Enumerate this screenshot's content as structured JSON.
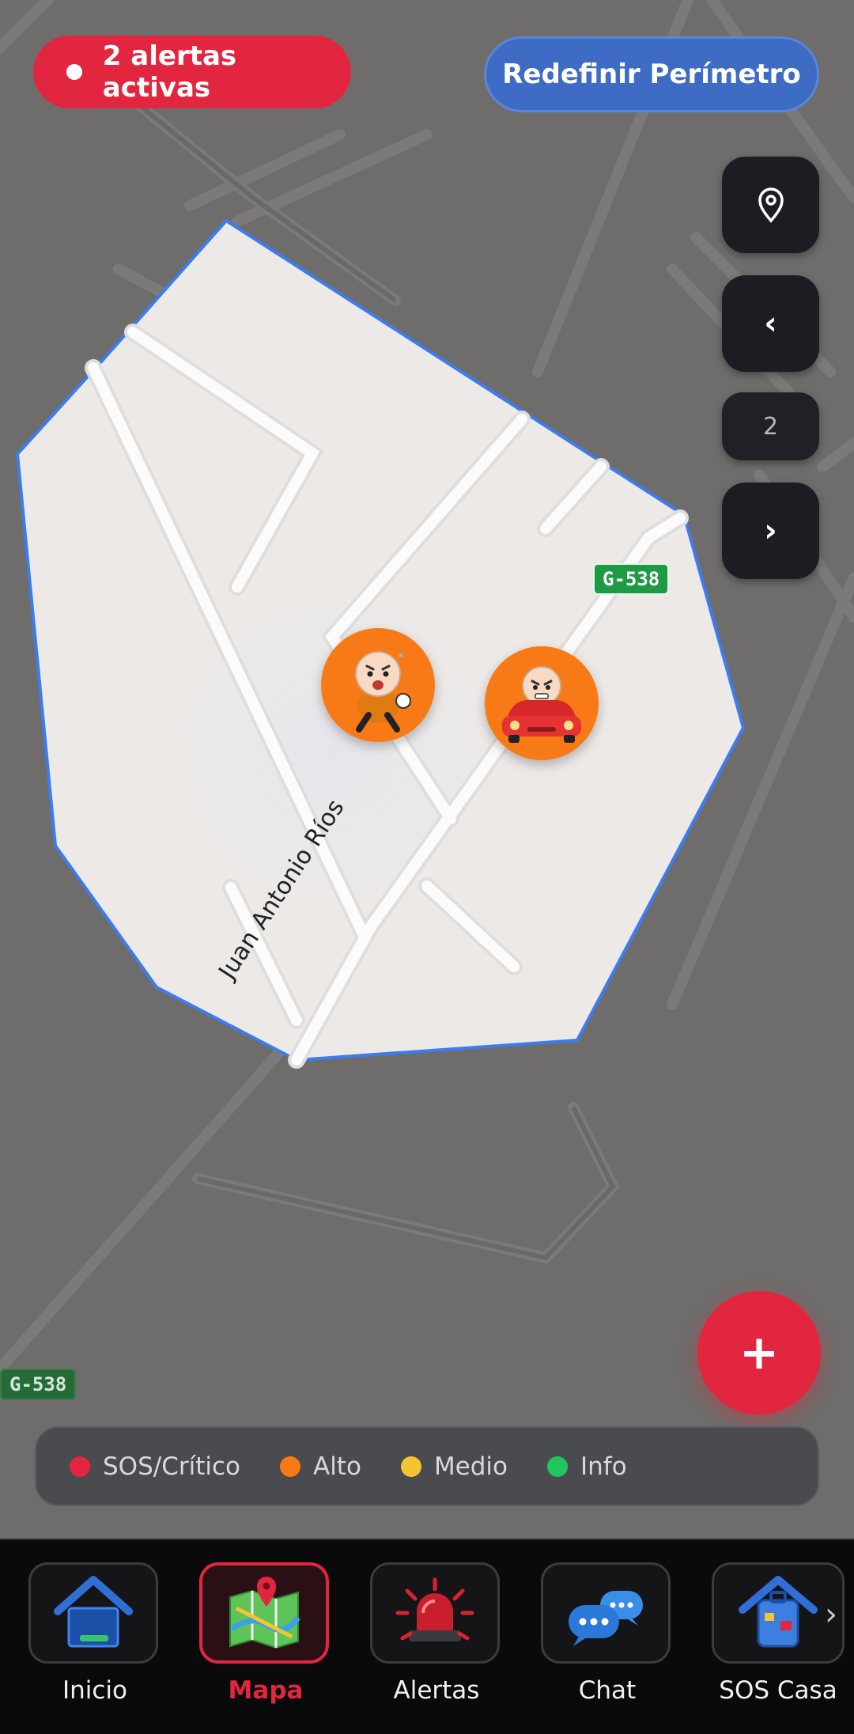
{
  "header": {
    "alerts_pill": "2 alertas activas",
    "perimeter_button": "Redefinir Perímetro"
  },
  "map_controls": {
    "page_number": "2",
    "prev_glyph": "‹",
    "next_glyph": "›"
  },
  "map": {
    "road_label_main": "G-538",
    "road_label_bottom": "G-538",
    "street_name": "Juan Antonio Ríos"
  },
  "fab": {
    "label": "+"
  },
  "legend": {
    "items": [
      {
        "label": "SOS/Crítico",
        "color": "#e3263f"
      },
      {
        "label": "Alto",
        "color": "#f77a16"
      },
      {
        "label": "Medio",
        "color": "#f5c531"
      },
      {
        "label": "Info",
        "color": "#22c55e"
      }
    ]
  },
  "nav": {
    "items": [
      {
        "label": "Inicio",
        "icon": "home-icon"
      },
      {
        "label": "Mapa",
        "icon": "map-icon",
        "active": true
      },
      {
        "label": "Alertas",
        "icon": "siren-icon"
      },
      {
        "label": "Chat",
        "icon": "chat-icon"
      },
      {
        "label": "SOS Casa",
        "icon": "luggage-icon"
      }
    ],
    "more_glyph": "›"
  },
  "colors": {
    "accent_red": "#e3263f",
    "accent_blue": "#3e6cc5",
    "marker_orange": "#f77a16",
    "perimeter_stroke": "#3b7cf0"
  }
}
